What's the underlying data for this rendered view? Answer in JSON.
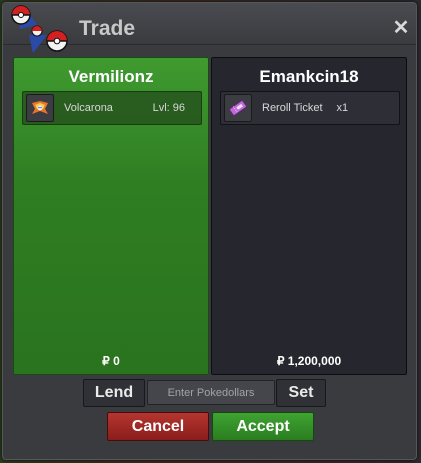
{
  "window": {
    "title": "Trade",
    "close_symbol": "✕"
  },
  "players": {
    "left": {
      "name": "Vermilionz",
      "item": {
        "icon": "volcarona-icon",
        "name": "Volcarona",
        "extra": "Lvl: 96"
      },
      "money": "₽ 0"
    },
    "right": {
      "name": "Emankcin18",
      "item": {
        "icon": "reroll-ticket-icon",
        "name": "Reroll Ticket",
        "extra": "x1"
      },
      "money": "₽ 1,200,000"
    }
  },
  "controls": {
    "lend_label": "Lend",
    "money_placeholder": "Enter Pokedollars",
    "set_label": "Set",
    "cancel_label": "Cancel",
    "accept_label": "Accept"
  },
  "colors": {
    "left_panel": "#2f7e22",
    "right_panel": "#26262e",
    "cancel": "#a32a25",
    "accept": "#35902a"
  }
}
